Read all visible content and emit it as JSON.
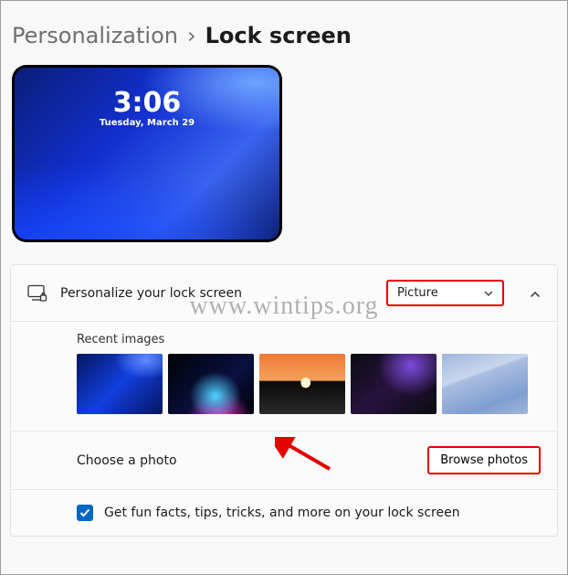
{
  "breadcrumb": {
    "parent": "Personalization",
    "sep": "›",
    "current": "Lock screen"
  },
  "preview": {
    "time": "3:06",
    "date": "Tuesday, March 29"
  },
  "personalize": {
    "label": "Personalize your lock screen",
    "selected": "Picture"
  },
  "recent": {
    "title": "Recent images"
  },
  "choose": {
    "label": "Choose a photo",
    "button": "Browse photos"
  },
  "funfacts": {
    "label": "Get fun facts, tips, tricks, and more on your lock screen",
    "checked": true
  },
  "watermark": "www.wintips.org"
}
